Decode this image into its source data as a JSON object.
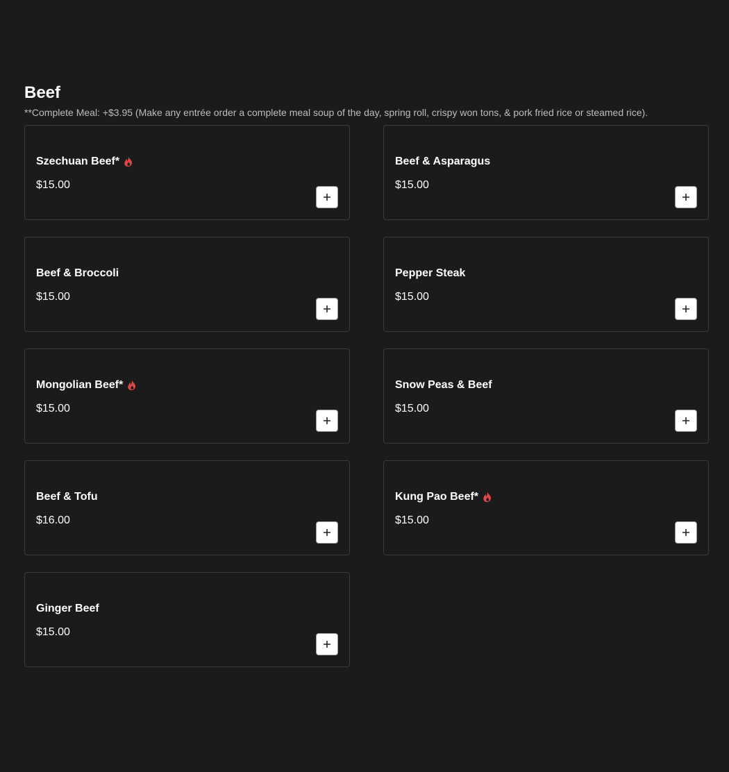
{
  "section": {
    "title": "Beef",
    "note": "**Complete Meal: +$3.95 (Make any entrée order a complete meal soup of the day, spring roll, crispy won tons, & pork fried rice or steamed rice)."
  },
  "colors": {
    "background": "#1b1b1b",
    "spicy": "#e04848",
    "card_border": "#3a3a3a"
  },
  "items": [
    {
      "name": "Szechuan Beef*",
      "price": "$15.00",
      "spicy": true,
      "icon": "fire-icon"
    },
    {
      "name": "Beef & Asparagus",
      "price": "$15.00",
      "spicy": false
    },
    {
      "name": "Beef & Broccoli",
      "price": "$15.00",
      "spicy": false
    },
    {
      "name": "Pepper Steak",
      "price": "$15.00",
      "spicy": false
    },
    {
      "name": "Mongolian Beef*",
      "price": "$15.00",
      "spicy": true,
      "icon": "fire-icon"
    },
    {
      "name": "Snow Peas & Beef",
      "price": "$15.00",
      "spicy": false
    },
    {
      "name": "Beef & Tofu",
      "price": "$16.00",
      "spicy": false
    },
    {
      "name": "Kung Pao Beef*",
      "price": "$15.00",
      "spicy": true,
      "icon": "fire-icon"
    },
    {
      "name": "Ginger Beef",
      "price": "$15.00",
      "spicy": false
    }
  ]
}
